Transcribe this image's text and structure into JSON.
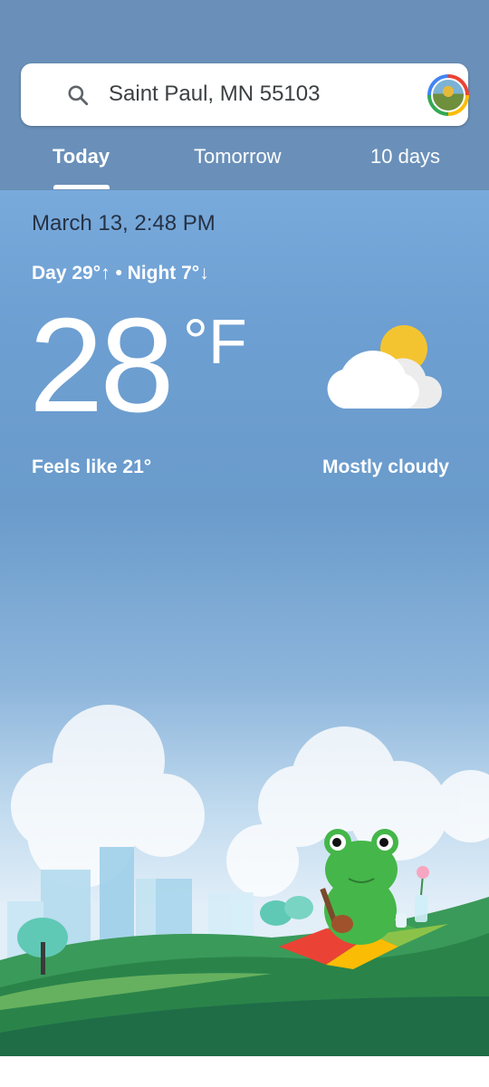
{
  "search": {
    "location": "Saint Paul, MN 55103"
  },
  "tabs": [
    "Today",
    "Tomorrow",
    "10 days"
  ],
  "weather": {
    "datetime": "March 13, 2:48 PM",
    "day_night": "Day 29°↑ • Night 7°↓",
    "temperature": "28",
    "unit": "°F",
    "feels_like": "Feels like 21°",
    "condition": "Mostly cloudy"
  },
  "colors": {
    "header": "#6a90b9",
    "sky": "#79aadc",
    "text_dark": "#263244",
    "grass": "#2e8b4a",
    "frog": "#45b649"
  },
  "icons": {
    "search": "search-icon",
    "avatar": "account-avatar",
    "condition": "mostly-cloudy-icon"
  }
}
